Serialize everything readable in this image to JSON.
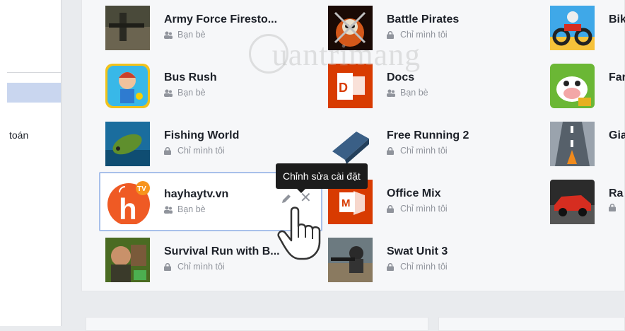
{
  "sidebar": {
    "label": "toán"
  },
  "tooltip": "Chỉnh sửa cài đặt",
  "watermark": "uantrimang",
  "privacy": {
    "friends": "Bạn bè",
    "only_me": "Chỉ mình tôi"
  },
  "apps": [
    {
      "name": "Army Force Firesto...",
      "privacy": "Bạn bè",
      "icon": "army-force-icon"
    },
    {
      "name": "Battle Pirates",
      "privacy": "Chỉ mình tôi",
      "icon": "battle-pirates-icon"
    },
    {
      "name": "Bik",
      "privacy": "",
      "icon": "bike-game-icon"
    },
    {
      "name": "Bus Rush",
      "privacy": "Bạn bè",
      "icon": "bus-rush-icon"
    },
    {
      "name": "Docs",
      "privacy": "Bạn bè",
      "icon": "docs-icon"
    },
    {
      "name": "Far",
      "privacy": "",
      "icon": "farm-game-icon"
    },
    {
      "name": "Fishing World",
      "privacy": "Chỉ mình tôi",
      "icon": "fishing-world-icon"
    },
    {
      "name": "Free Running 2",
      "privacy": "Chỉ mình tôi",
      "icon": "free-running-icon"
    },
    {
      "name": "Gia",
      "privacy": "",
      "icon": "road-game-icon"
    },
    {
      "name": "hayhaytv.vn",
      "privacy": "Bạn bè",
      "icon": "hayhaytv-icon"
    },
    {
      "name": "Office Mix",
      "privacy": "Chỉ mình tôi",
      "icon": "office-mix-icon"
    },
    {
      "name": "Ra",
      "privacy": "",
      "icon": "racing-game-icon"
    },
    {
      "name": "Survival Run with B...",
      "privacy": "Chỉ mình tôi",
      "icon": "survival-run-icon"
    },
    {
      "name": "Swat Unit 3",
      "privacy": "Chỉ mình tôi",
      "icon": "swat-unit-icon"
    }
  ],
  "colors": {
    "highlight_border": "#a8c0ea",
    "sidebar_selected": "#c9d6ef",
    "tooltip_bg": "#1c1c1c"
  }
}
